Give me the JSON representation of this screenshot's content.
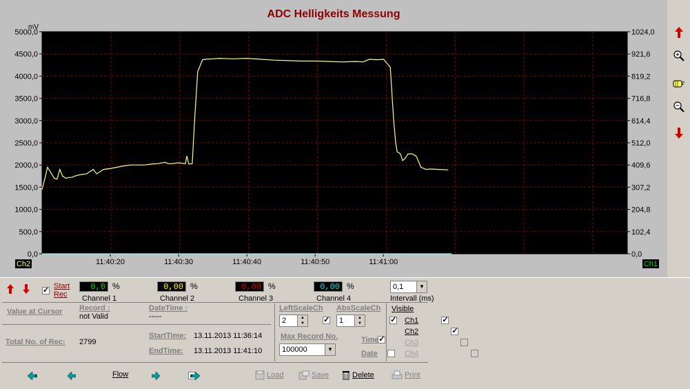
{
  "chart_data": {
    "type": "line",
    "title": "ADC Helligkeits Messung",
    "left_unit": "mV",
    "left_ticks": [
      "0,0",
      "500,0",
      "1000,0",
      "1500,0",
      "2000,0",
      "2500,0",
      "3000,0",
      "3500,0",
      "4000,0",
      "4500,0",
      "5000,0"
    ],
    "right_ticks": [
      "0,0",
      "102,4",
      "204,8",
      "307,2",
      "409,6",
      "512,0",
      "614,4",
      "716,8",
      "819,2",
      "921,6",
      "1024,0"
    ],
    "ylim": [
      0,
      5000
    ],
    "x_ticks": [
      "11:40:20",
      "11:40:30",
      "11:40:40",
      "11:40:50",
      "11:41:00"
    ],
    "xlim_seconds_from_start": [
      0,
      60
    ],
    "left_axis_tag": "Ch2",
    "right_axis_tag": "Ch1",
    "grid": true,
    "series": [
      {
        "color": "#ffff80",
        "x": [
          0,
          0.5,
          0.8,
          1.2,
          1.8,
          2.2,
          2.6,
          3.0,
          3.5,
          4.0,
          4.4,
          4.8,
          5.5,
          6.5,
          7.5,
          8.0,
          8.5,
          9,
          10,
          11,
          12,
          13,
          14,
          15,
          16,
          17,
          18,
          18.5,
          19,
          20,
          21,
          21.2,
          21.5,
          22.0,
          22.3,
          22.8,
          23.5,
          24,
          25,
          26,
          28,
          30,
          32,
          34,
          36,
          38,
          40,
          42,
          44,
          46,
          47,
          48,
          49,
          50,
          51,
          51.5,
          51.8,
          52.0,
          52.5,
          52.8,
          53.2,
          53.6,
          54.2,
          54.8,
          55.5,
          56.2,
          57,
          58,
          59.5
        ],
        "y": [
          1450,
          1750,
          1950,
          1850,
          1700,
          1680,
          1900,
          1750,
          1700,
          1720,
          1720,
          1750,
          1780,
          1800,
          1900,
          1800,
          1850,
          1900,
          1920,
          1950,
          1980,
          2000,
          2000,
          2000,
          2020,
          2030,
          2060,
          2030,
          2030,
          2050,
          2030,
          2200,
          2020,
          2030,
          2900,
          4100,
          4370,
          4380,
          4390,
          4400,
          4390,
          4400,
          4380,
          4360,
          4350,
          4340,
          4340,
          4330,
          4320,
          4330,
          4320,
          4380,
          4370,
          4380,
          4200,
          3000,
          2500,
          2300,
          2250,
          2100,
          2150,
          2250,
          2250,
          2200,
          1950,
          1900,
          1910,
          1900,
          1890
        ]
      },
      {
        "color": "#80ffff",
        "x": [
          0,
          60
        ],
        "y": [
          0,
          0
        ]
      }
    ]
  },
  "toolbar": {
    "icons": [
      "arrow-up-icon",
      "zoom-in-icon",
      "hand-pointer-icon",
      "zoom-out-icon",
      "arrow-down-icon"
    ]
  },
  "controls": {
    "start_rec_line1": "Start",
    "start_rec_line2": "Rec",
    "channels": [
      {
        "value": "0,0",
        "label": "Channel 1",
        "color": "#00e000"
      },
      {
        "value": "0,00",
        "label": "Channel 2",
        "color": "#ffff00"
      },
      {
        "value": "0,00",
        "label": "Channel 3",
        "color": "#e00000"
      },
      {
        "value": "0,00",
        "label": "Channel 4",
        "color": "#00ffff"
      }
    ],
    "percent": "%",
    "interval_value": "0,1",
    "interval_label": "Intervall (ms)"
  },
  "info": {
    "value_at_cursor": "Value at Cursor",
    "record_label": "Record :",
    "record_value": "not Valid",
    "datetime_label": "DateTime :",
    "datetime_value": "-----",
    "total_label": "Total No. of Rec:",
    "total_value": "2799",
    "start_label": "StartTime:",
    "start_value": "13.11.2013 11:36:14",
    "end_label": "EndTime:",
    "end_value": "13.11.2013 11:41:10"
  },
  "scale": {
    "left_label": "LeftScaleCh",
    "left_value": "2",
    "abs_label": "AbsScaleCh",
    "abs_value": "1",
    "max_label": "Max Record No.",
    "max_value": "100000",
    "time_label": "Time",
    "date_label": "Date"
  },
  "visible": {
    "label": "Visible",
    "items": [
      "Ch1",
      "Ch2",
      "Ch3",
      "Ch4"
    ]
  },
  "bottom": {
    "flow_label": "Flow",
    "load_label": "Load",
    "save_label": "Save",
    "delete_label": "Delete",
    "print_label": "Print"
  }
}
